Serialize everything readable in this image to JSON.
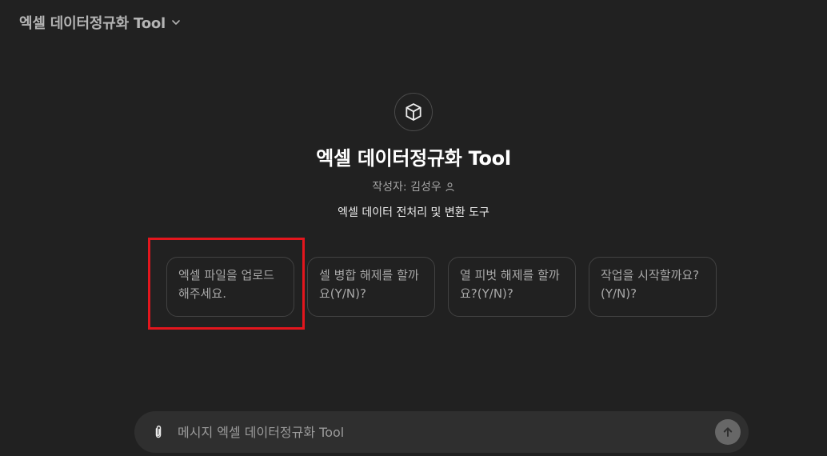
{
  "header": {
    "model_name": "엑셀 데이터정규화 Tool",
    "chevron_icon": "chevron-down-icon"
  },
  "profile": {
    "avatar_icon": "cube-icon",
    "title": "엑셀 데이터정규화 Tool",
    "author": "작성자: 김성우",
    "author_icon": "person-icon",
    "description": "엑셀 데이터 전처리 및 변환 도구"
  },
  "starters": [
    {
      "label": "엑셀 파일을 업로드해주세요."
    },
    {
      "label": "셀 병합 해제를 할까요(Y/N)?"
    },
    {
      "label": "열 피벗 해제를 할까요?(Y/N)?"
    },
    {
      "label": "작업을 시작할까요?(Y/N)?"
    }
  ],
  "composer": {
    "placeholder": "메시지 엑셀 데이터정규화 Tool",
    "value": "",
    "attach_icon": "paperclip-icon",
    "send_icon": "arrow-up-icon"
  },
  "colors": {
    "background": "#212121",
    "composer_bg": "#2f2f2f",
    "highlight": "#e3161d"
  }
}
